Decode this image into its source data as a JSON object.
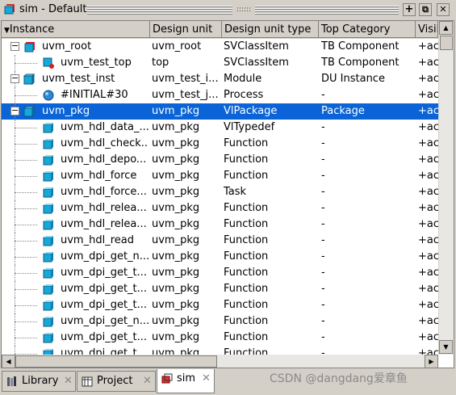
{
  "window": {
    "title": "sim - Default",
    "grip_text": "::::::"
  },
  "title_buttons": {
    "add": "+",
    "restore": "⧉",
    "close": "✕"
  },
  "columns": [
    "Instance",
    "Design unit",
    "Design unit type",
    "Top Category",
    "Visil"
  ],
  "header_sort_arrow": "▼",
  "rows": [
    {
      "indent": 0,
      "expander": "−",
      "icon": "class-root",
      "instance": "uvm_root",
      "unit": "uvm_root",
      "type": "SVClassItem",
      "category": "TB Component",
      "vis": "+ac"
    },
    {
      "indent": 1,
      "expander": "",
      "icon": "class-test",
      "instance": "uvm_test_top",
      "unit": "top",
      "type": "SVClassItem",
      "category": "TB Component",
      "vis": "+ac"
    },
    {
      "indent": 0,
      "expander": "−",
      "icon": "module",
      "instance": "uvm_test_inst",
      "unit": "uvm_test_i...",
      "type": "Module",
      "category": "DU Instance",
      "vis": "+ac"
    },
    {
      "indent": 1,
      "expander": "",
      "icon": "process",
      "instance": "#INITIAL#30",
      "unit": "uvm_test_j...",
      "type": "Process",
      "category": "-",
      "vis": "+ac"
    },
    {
      "indent": 0,
      "expander": "−",
      "icon": "package",
      "instance": "uvm_pkg",
      "unit": "uvm_pkg",
      "type": "VlPackage",
      "category": "Package",
      "vis": "+ac",
      "selected": true
    },
    {
      "indent": 1,
      "expander": "",
      "icon": "typedef",
      "instance": "uvm_hdl_data_...",
      "unit": "uvm_pkg",
      "type": "VlTypedef",
      "category": "-",
      "vis": "+ac"
    },
    {
      "indent": 1,
      "expander": "",
      "icon": "function",
      "instance": "uvm_hdl_check...",
      "unit": "uvm_pkg",
      "type": "Function",
      "category": "-",
      "vis": "+ac"
    },
    {
      "indent": 1,
      "expander": "",
      "icon": "function",
      "instance": "uvm_hdl_depo...",
      "unit": "uvm_pkg",
      "type": "Function",
      "category": "-",
      "vis": "+ac"
    },
    {
      "indent": 1,
      "expander": "",
      "icon": "function",
      "instance": "uvm_hdl_force",
      "unit": "uvm_pkg",
      "type": "Function",
      "category": "-",
      "vis": "+ac"
    },
    {
      "indent": 1,
      "expander": "",
      "icon": "task",
      "instance": "uvm_hdl_force...",
      "unit": "uvm_pkg",
      "type": "Task",
      "category": "-",
      "vis": "+ac"
    },
    {
      "indent": 1,
      "expander": "",
      "icon": "function",
      "instance": "uvm_hdl_relea...",
      "unit": "uvm_pkg",
      "type": "Function",
      "category": "-",
      "vis": "+ac"
    },
    {
      "indent": 1,
      "expander": "",
      "icon": "function",
      "instance": "uvm_hdl_relea...",
      "unit": "uvm_pkg",
      "type": "Function",
      "category": "-",
      "vis": "+ac"
    },
    {
      "indent": 1,
      "expander": "",
      "icon": "function",
      "instance": "uvm_hdl_read",
      "unit": "uvm_pkg",
      "type": "Function",
      "category": "-",
      "vis": "+ac"
    },
    {
      "indent": 1,
      "expander": "",
      "icon": "function",
      "instance": "uvm_dpi_get_n...",
      "unit": "uvm_pkg",
      "type": "Function",
      "category": "-",
      "vis": "+ac"
    },
    {
      "indent": 1,
      "expander": "",
      "icon": "function",
      "instance": "uvm_dpi_get_t...",
      "unit": "uvm_pkg",
      "type": "Function",
      "category": "-",
      "vis": "+ac"
    },
    {
      "indent": 1,
      "expander": "",
      "icon": "function",
      "instance": "uvm_dpi_get_t...",
      "unit": "uvm_pkg",
      "type": "Function",
      "category": "-",
      "vis": "+ac"
    },
    {
      "indent": 1,
      "expander": "",
      "icon": "function",
      "instance": "uvm_dpi_get_t...",
      "unit": "uvm_pkg",
      "type": "Function",
      "category": "-",
      "vis": "+ac"
    },
    {
      "indent": 1,
      "expander": "",
      "icon": "function",
      "instance": "uvm_dpi_get_n...",
      "unit": "uvm_pkg",
      "type": "Function",
      "category": "-",
      "vis": "+ac"
    },
    {
      "indent": 1,
      "expander": "",
      "icon": "function",
      "instance": "uvm_dpi_get_t...",
      "unit": "uvm_pkg",
      "type": "Function",
      "category": "-",
      "vis": "+ac"
    },
    {
      "indent": 1,
      "expander": "",
      "icon": "function",
      "instance": "uvm_dpi_get_t...",
      "unit": "uvm_pkg",
      "type": "Function",
      "category": "-",
      "vis": "+ac"
    }
  ],
  "scroll_arrows": {
    "up": "▲",
    "down": "▼",
    "left": "◀",
    "right": "▶"
  },
  "tabs": [
    {
      "label": "Library",
      "close": "✕",
      "icon": "library-icon"
    },
    {
      "label": "Project",
      "close": "✕",
      "icon": "project-icon"
    },
    {
      "label": "sim",
      "close": "✕",
      "icon": "sim-icon",
      "active": true
    }
  ],
  "watermark": "CSDN @dangdang爱章鱼",
  "colors": {
    "selection": "#0a64d7",
    "chrome": "#d4d0c8",
    "icon_cyan": "#18a8d8"
  }
}
